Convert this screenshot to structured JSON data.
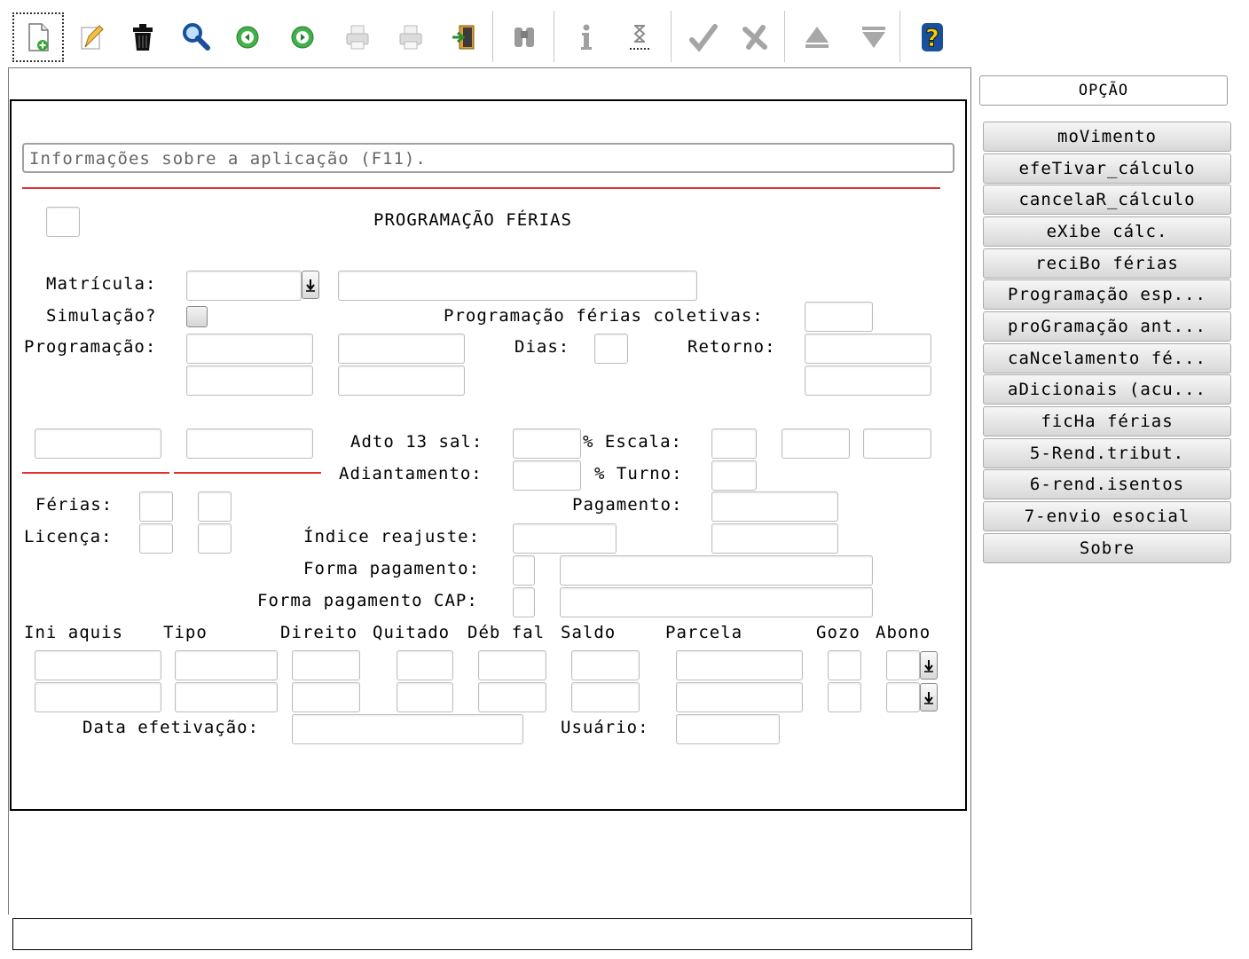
{
  "toolbar": {
    "buttons": [
      {
        "name": "new-icon"
      },
      {
        "name": "edit-icon"
      },
      {
        "name": "delete-icon"
      },
      {
        "name": "search-icon"
      },
      {
        "name": "previous-icon"
      },
      {
        "name": "next-icon"
      },
      {
        "name": "print-icon"
      },
      {
        "name": "print-disabled-icon"
      },
      {
        "name": "exit-icon"
      },
      {
        "name": "binoculars-icon"
      },
      {
        "name": "info-icon"
      },
      {
        "name": "hourglass-icon"
      },
      {
        "name": "confirm-icon"
      },
      {
        "name": "cancel-icon"
      },
      {
        "name": "up-icon"
      },
      {
        "name": "down-icon"
      },
      {
        "name": "help-icon"
      }
    ]
  },
  "info_bar": {
    "text": "Informações sobre a aplicação (F11)."
  },
  "form": {
    "title": "PROGRAMAÇÃO FÉRIAS",
    "labels": {
      "matricula": "Matrícula:",
      "simulacao": "Simulação?",
      "prog_ferias_coletivas": "Programação férias coletivas:",
      "programacao": "Programação:",
      "dias": "Dias:",
      "retorno": "Retorno:",
      "adto13": "Adto 13 sal:",
      "escala": "% Escala:",
      "adiantamento": "Adiantamento:",
      "turno": "% Turno:",
      "ferias": "Férias:",
      "pagamento": "Pagamento:",
      "licenca": "Licença:",
      "indice_reajuste": "Índice reajuste:",
      "forma_pagamento": "Forma pagamento:",
      "forma_pagamento_cap": "Forma pagamento CAP:",
      "data_efetivacao": "Data efetivação:",
      "usuario": "Usuário:"
    },
    "table_headers": {
      "ini_aquis": "Ini aquis",
      "tipo": "Tipo",
      "direito": "Direito",
      "quitado": "Quitado",
      "deb_fal": "Déb fal",
      "saldo": "Saldo",
      "parcela": "Parcela",
      "gozo": "Gozo",
      "abono": "Abono"
    }
  },
  "side_panel": {
    "header": "OPÇÃO",
    "options": [
      "moVimento",
      "efeTivar_cálculo",
      "cancelaR_cálculo",
      "eXibe cálc.",
      "reciBo férias",
      "Programação esp...",
      "proGramação ant...",
      "caNcelamento fé...",
      "aDicionais (acu...",
      "ficHa férias",
      "5-Rend.tribut.",
      "6-rend.isentos",
      "7-envio esocial",
      "Sobre"
    ]
  }
}
